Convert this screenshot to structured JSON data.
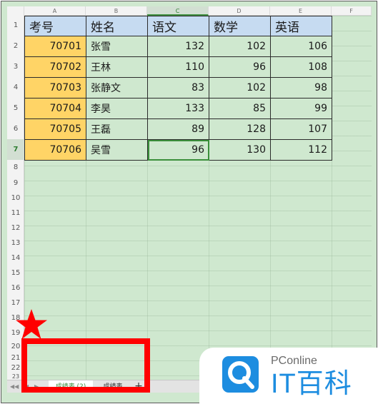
{
  "columns": [
    "A",
    "B",
    "C",
    "D",
    "E",
    "F"
  ],
  "active_column": "C",
  "rows": [
    "1",
    "2",
    "3",
    "4",
    "5",
    "6",
    "7",
    "8",
    "9",
    "10",
    "11",
    "12",
    "13",
    "14",
    "15",
    "16",
    "17",
    "18",
    "19",
    "20",
    "21",
    "22",
    "23"
  ],
  "active_row": "7",
  "table": {
    "headers": [
      "考号",
      "姓名",
      "语文",
      "数学",
      "英语"
    ],
    "data": [
      [
        "70701",
        "张雪",
        "132",
        "102",
        "106"
      ],
      [
        "70702",
        "王林",
        "110",
        "96",
        "108"
      ],
      [
        "70703",
        "张静文",
        "83",
        "102",
        "98"
      ],
      [
        "70704",
        "李昊",
        "133",
        "85",
        "99"
      ],
      [
        "70705",
        "王磊",
        "89",
        "128",
        "107"
      ],
      [
        "70706",
        "吴雪",
        "96",
        "130",
        "112"
      ]
    ]
  },
  "sheet_tabs": {
    "active": "成绩表 (2)",
    "other": "成绩表",
    "add": "+"
  },
  "nav_buttons": [
    "◀◀",
    "◀",
    "▶"
  ],
  "watermark": {
    "brand_top": "PConline",
    "brand_cn": "IT百科"
  },
  "colors": {
    "cell_bg": "#cfe8cf",
    "header_bg": "#c6dbf1",
    "id_bg": "#ffd466",
    "annotation_red": "#ff0000",
    "brand_blue": "#1d8de0"
  },
  "icons": [
    "star-icon",
    "pconline-logo-icon"
  ]
}
